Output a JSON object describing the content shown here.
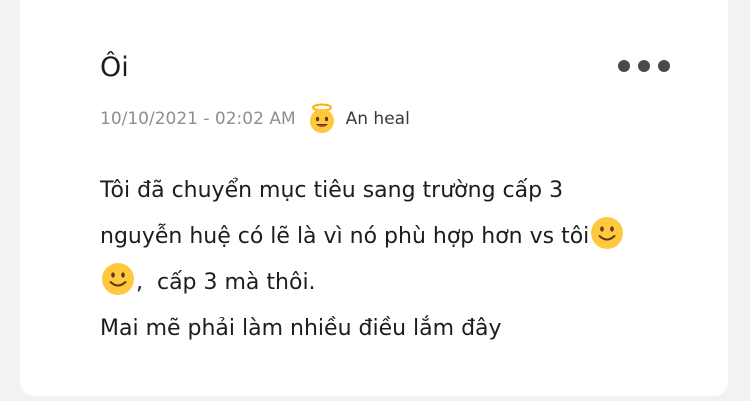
{
  "post": {
    "title": "Ôi",
    "timestamp": "10/10/2021 - 02:02 AM",
    "author": "An heal",
    "author_badge_icon": "smiling-face-with-halo",
    "more_icon": "more-dots",
    "content": {
      "line1": "Tôi đã chuyển mục tiêu sang trường cấp 3",
      "line2": "nguyễn huệ có lẽ là vì nó phù hợp hơn vs tôi",
      "line3": ",  cấp 3 mà thôi.",
      "line4": "Mai mẽ phải làm nhiều điều lắm đây",
      "emoji": "slightly-smiling-face"
    }
  },
  "colors": {
    "background": "#f2f2f5",
    "card": "#ffffff",
    "emoji_yellow": "#ffc83d",
    "text": "#1d1d1f",
    "meta_text": "#8e8e93"
  }
}
